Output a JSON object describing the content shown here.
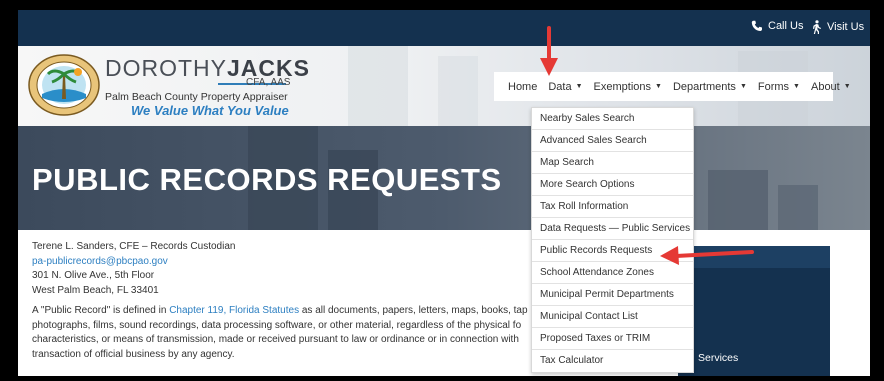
{
  "utility": {
    "call_label": "Call Us",
    "visit_label": "Visit Us"
  },
  "brand": {
    "name_light": "DOROTHY",
    "name_bold": "JACKS",
    "credentials": "CFA, AAS",
    "subtitle": "Palm Beach County Property Appraiser",
    "slogan": "We Value What You Value",
    "seal_icon": "county-seal-logo"
  },
  "nav": {
    "items": [
      {
        "label": "Home",
        "has_caret": false
      },
      {
        "label": "Data",
        "has_caret": true
      },
      {
        "label": "Exemptions",
        "has_caret": true
      },
      {
        "label": "Departments",
        "has_caret": true
      },
      {
        "label": "Forms",
        "has_caret": true
      },
      {
        "label": "About",
        "has_caret": true
      }
    ],
    "caret": "▼"
  },
  "hero": {
    "title": "PUBLIC RECORDS REQUESTS"
  },
  "dropdown": {
    "items": [
      "Nearby Sales Search",
      "Advanced Sales Search",
      "Map Search",
      "More Search Options",
      "Tax Roll Information",
      "Data Requests — Public Services",
      "Public Records Requests",
      "School Attendance Zones",
      "Municipal Permit Departments",
      "Municipal Contact List",
      "Proposed Taxes or TRIM",
      "Tax Calculator"
    ]
  },
  "contact": {
    "name_line": "Terene L. Sanders, CFE – Records Custodian",
    "email": "pa-publicrecords@pbcpao.gov",
    "address1": "301 N. Olive Ave., 5th Floor",
    "address2": "West Palm Beach, FL 33401"
  },
  "paragraph": {
    "text_before": "A \"Public Record\" is defined in ",
    "link": "Chapter 119, Florida Statutes",
    "line1_after": " as all documents, papers, letters, maps, books, tap",
    "line2": "photographs, films, sound recordings, data processing software, or other material, regardless of the physical fo",
    "line3": "characteristics, or means of transmission, made or received pursuant to law or ordinance or in connection with",
    "line4": "transaction of official business by any agency."
  },
  "side_panel": {
    "visible_text": "Services"
  },
  "colors": {
    "topbar": "#14314f",
    "accent_blue": "#2d7fc1",
    "annotation_red": "#e53935"
  }
}
